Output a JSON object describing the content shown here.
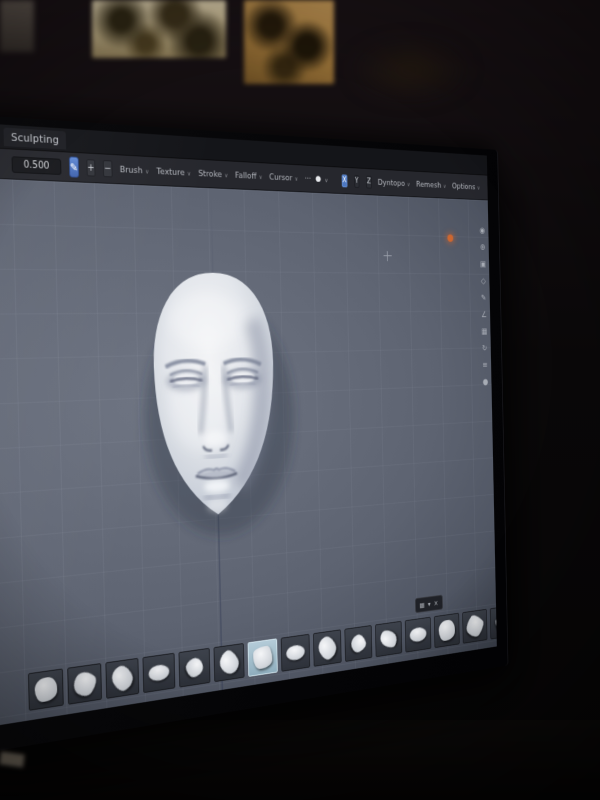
{
  "topbar": {
    "workspace_tab": "Sculpting"
  },
  "toolbar": {
    "radius_value": "0.500",
    "brush_icon_glyph": "✎",
    "increase_label": "+",
    "decrease_label": "−",
    "caret_glyph": "∨",
    "overflow_dots_glyph": "⋯",
    "shading_sphere_glyph": "●",
    "menus": [
      {
        "label": "Brush"
      },
      {
        "label": "Texture"
      },
      {
        "label": "Stroke"
      },
      {
        "label": "Falloff"
      },
      {
        "label": "Cursor"
      }
    ],
    "symmetry_buttons": [
      {
        "label": "X",
        "active": true
      },
      {
        "label": "Y",
        "active": false
      },
      {
        "label": "Z",
        "active": false
      }
    ],
    "right_panels": [
      {
        "label": "Dyntopo"
      },
      {
        "label": "Remesh"
      },
      {
        "label": "Options"
      }
    ],
    "accent_color": "#4a78c8"
  },
  "viewport": {
    "side_toolbar_icons": [
      {
        "name": "gizmo-icon",
        "glyph": "◉"
      },
      {
        "name": "zoom-icon",
        "glyph": "⊕"
      },
      {
        "name": "camera-view-icon",
        "glyph": "▣"
      },
      {
        "name": "toggle-overlays-icon",
        "glyph": "◇"
      },
      {
        "name": "annotate-icon",
        "glyph": "✎"
      },
      {
        "name": "measure-icon",
        "glyph": "∠"
      },
      {
        "name": "grid-icon",
        "glyph": "▦"
      },
      {
        "name": "orbit-icon",
        "glyph": "↻"
      },
      {
        "name": "options-icon",
        "glyph": "≡"
      },
      {
        "name": "dot-icon",
        "glyph": "●"
      }
    ],
    "cursor_marker_color": "#d4652a"
  },
  "asset_shelf": {
    "header_icons": [
      {
        "name": "grid-icon",
        "glyph": "▦"
      },
      {
        "name": "collapse-icon",
        "glyph": "▾"
      },
      {
        "name": "close-icon",
        "glyph": "×"
      }
    ],
    "thumbnail_count": 16,
    "selected_index": 7
  }
}
